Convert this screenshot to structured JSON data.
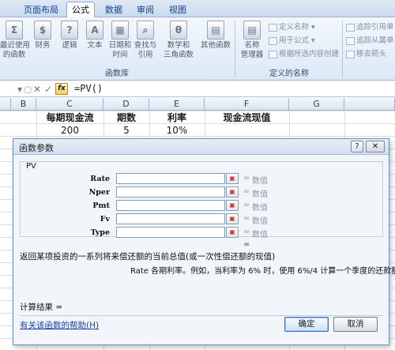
{
  "ribbon_tabs": [
    "页面布局",
    "公式",
    "数据",
    "审阅",
    "视图"
  ],
  "ribbon_buttons": [
    {
      "line1": "最近使用",
      "line2": "的函数",
      "icon": "Σ"
    },
    {
      "line1": "财务",
      "line2": "",
      "icon": "$"
    },
    {
      "line1": "逻辑",
      "line2": "",
      "icon": "?"
    },
    {
      "line1": "文本",
      "line2": "",
      "icon": "A"
    },
    {
      "line1": "日期和",
      "line2": "时间",
      "icon": "▦"
    },
    {
      "line1": "查找与",
      "line2": "引用",
      "icon": "⌕"
    },
    {
      "line1": "数学和",
      "line2": "三角函数",
      "icon": "θ"
    },
    {
      "line1": "其他函数",
      "line2": "",
      "icon": "▤"
    }
  ],
  "group_function_library": "函数库",
  "name_manager": {
    "line1": "名称",
    "line2": "管理器",
    "icon": "▤"
  },
  "names_small": [
    "定义名称",
    "用于公式",
    "根据所选内容创建"
  ],
  "group_defined_names": "定义的名称",
  "audit_small": [
    "追踪引用单",
    "追踪从属单",
    "移去箭头"
  ],
  "formula_bar": {
    "formula": "=PV()"
  },
  "columns": [
    "B",
    "C",
    "D",
    "E",
    "F",
    "G"
  ],
  "sheet": {
    "headers": [
      "每期现金流",
      "期数",
      "利率",
      "现金流现值"
    ],
    "row": [
      "200",
      "5",
      "10%"
    ]
  },
  "dialog": {
    "title": "函数参数",
    "help_btn": "?",
    "function_name": "PV",
    "args": [
      {
        "name": "Rate",
        "eq": "=",
        "value": "数值"
      },
      {
        "name": "Nper",
        "eq": "=",
        "value": "数值"
      },
      {
        "name": "Pmt",
        "eq": "=",
        "value": "数值"
      },
      {
        "name": "Fv",
        "eq": "=",
        "value": "数值"
      },
      {
        "name": "Type",
        "eq": "=",
        "value": "数值"
      }
    ],
    "equals": "=",
    "description": "返回某项投资的一系列将来偿还额的当前总值(或一次性偿还额的现值)",
    "arg_help": "Rate  各期利率。例如，当利率为 6% 时，使用 6%/4 计算一个季度的还款额",
    "result_label": "计算结果 =",
    "help_link": "有关该函数的帮助(H)",
    "ok": "确定",
    "cancel": "取消"
  }
}
